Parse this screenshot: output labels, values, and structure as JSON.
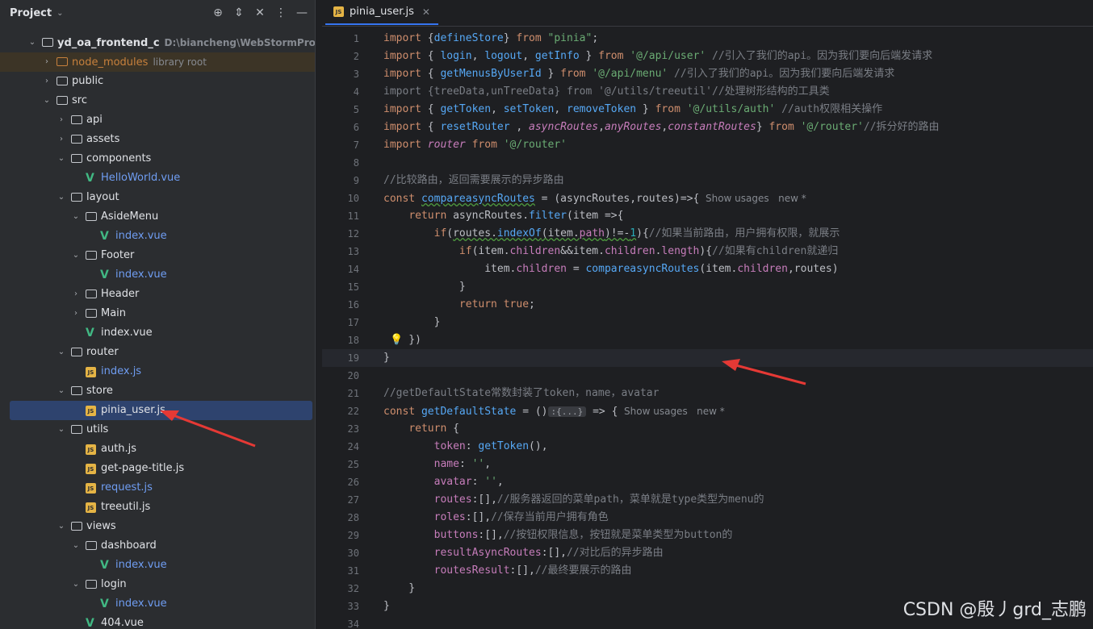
{
  "project_panel": {
    "title": "Project",
    "tree": [
      {
        "label": "yd_oa_frontend_c",
        "hint": "D:\\biancheng\\WebStormProject\\yd_oa_fr",
        "type": "folder",
        "depth": 0,
        "open": true,
        "bold": true
      },
      {
        "label": "node_modules",
        "hint": "library root",
        "type": "folder",
        "depth": 1,
        "open": false,
        "excluded": true
      },
      {
        "label": "public",
        "type": "folder",
        "depth": 1,
        "open": false
      },
      {
        "label": "src",
        "type": "folder",
        "depth": 1,
        "open": true
      },
      {
        "label": "api",
        "type": "folder",
        "depth": 2,
        "open": false
      },
      {
        "label": "assets",
        "type": "folder",
        "depth": 2,
        "open": false
      },
      {
        "label": "components",
        "type": "folder",
        "depth": 2,
        "open": true
      },
      {
        "label": "HelloWorld.vue",
        "type": "vue",
        "depth": 3,
        "blue": true
      },
      {
        "label": "layout",
        "type": "folder",
        "depth": 2,
        "open": true
      },
      {
        "label": "AsideMenu",
        "type": "folder",
        "depth": 3,
        "open": true
      },
      {
        "label": "index.vue",
        "type": "vue",
        "depth": 4,
        "blue": true
      },
      {
        "label": "Footer",
        "type": "folder",
        "depth": 3,
        "open": true
      },
      {
        "label": "index.vue",
        "type": "vue",
        "depth": 4,
        "blue": true
      },
      {
        "label": "Header",
        "type": "folder",
        "depth": 3,
        "open": false
      },
      {
        "label": "Main",
        "type": "folder",
        "depth": 3,
        "open": false
      },
      {
        "label": "index.vue",
        "type": "vue",
        "depth": 3
      },
      {
        "label": "router",
        "type": "folder",
        "depth": 2,
        "open": true
      },
      {
        "label": "index.js",
        "type": "js",
        "depth": 3,
        "blue": true
      },
      {
        "label": "store",
        "type": "folder",
        "depth": 2,
        "open": true
      },
      {
        "label": "pinia_user.js",
        "type": "js",
        "depth": 3,
        "selected": true
      },
      {
        "label": "utils",
        "type": "folder",
        "depth": 2,
        "open": true
      },
      {
        "label": "auth.js",
        "type": "js",
        "depth": 3
      },
      {
        "label": "get-page-title.js",
        "type": "js",
        "depth": 3
      },
      {
        "label": "request.js",
        "type": "js",
        "depth": 3,
        "blue": true
      },
      {
        "label": "treeutil.js",
        "type": "js",
        "depth": 3
      },
      {
        "label": "views",
        "type": "folder",
        "depth": 2,
        "open": true
      },
      {
        "label": "dashboard",
        "type": "folder",
        "depth": 3,
        "open": true
      },
      {
        "label": "index.vue",
        "type": "vue",
        "depth": 4,
        "blue": true
      },
      {
        "label": "login",
        "type": "folder",
        "depth": 3,
        "open": true
      },
      {
        "label": "index.vue",
        "type": "vue",
        "depth": 4,
        "blue": true
      },
      {
        "label": "404.vue",
        "type": "vue",
        "depth": 3
      }
    ]
  },
  "editor": {
    "tab_label": "pinia_user.js",
    "current_line": 19,
    "lines": [
      [
        [
          "k",
          "import "
        ],
        [
          "",
          "{"
        ],
        [
          "f",
          "defineStore"
        ],
        [
          "",
          "} "
        ],
        [
          "k",
          "from "
        ],
        [
          "s",
          "\"pinia\""
        ],
        [
          "",
          ";"
        ]
      ],
      [
        [
          "k",
          "import "
        ],
        [
          "",
          "{ "
        ],
        [
          "f",
          "login"
        ],
        [
          "",
          ", "
        ],
        [
          "f",
          "logout"
        ],
        [
          "",
          ", "
        ],
        [
          "f",
          "getInfo"
        ],
        [
          "",
          " } "
        ],
        [
          "k",
          "from "
        ],
        [
          "s",
          "'@/api/user'"
        ],
        [
          "c",
          " //引入了我们的api。因为我们要向后端发请求"
        ]
      ],
      [
        [
          "k",
          "import "
        ],
        [
          "",
          "{ "
        ],
        [
          "f",
          "getMenusByUserId"
        ],
        [
          "",
          " } "
        ],
        [
          "k",
          "from "
        ],
        [
          "s",
          "'@/api/menu'"
        ],
        [
          "c",
          " //引入了我们的api。因为我们要向后端发请求"
        ]
      ],
      [
        [
          "dim",
          "import {treeData,unTreeData} from '@/utils/treeutil'//处理树形结构的工具类"
        ]
      ],
      [
        [
          "k",
          "import "
        ],
        [
          "",
          "{ "
        ],
        [
          "f",
          "getToken"
        ],
        [
          "",
          ", "
        ],
        [
          "f",
          "setToken"
        ],
        [
          "",
          ", "
        ],
        [
          "f",
          "removeToken"
        ],
        [
          "",
          " } "
        ],
        [
          "k",
          "from "
        ],
        [
          "s",
          "'@/utils/auth'"
        ],
        [
          "c",
          " //auth权限相关操作"
        ]
      ],
      [
        [
          "k",
          "import "
        ],
        [
          "",
          "{ "
        ],
        [
          "f",
          "resetRouter"
        ],
        [
          "",
          " , "
        ],
        [
          "i",
          "asyncRoutes"
        ],
        [
          "",
          ","
        ],
        [
          "i",
          "anyRoutes"
        ],
        [
          "",
          ","
        ],
        [
          "i",
          "constantRoutes"
        ],
        [
          "",
          "} "
        ],
        [
          "k",
          "from "
        ],
        [
          "s",
          "'@/router'"
        ],
        [
          "c",
          "//拆分好的路由"
        ]
      ],
      [
        [
          "k",
          "import "
        ],
        [
          "i",
          "router"
        ],
        [
          "k",
          " from "
        ],
        [
          "s",
          "'@/router'"
        ]
      ],
      [],
      [
        [
          "c",
          "//比较路由，返回需要展示的异步路由"
        ]
      ],
      [
        [
          "k",
          "const "
        ],
        [
          "fu",
          "compareasyncRoutes"
        ],
        [
          "",
          " = (asyncRoutes,routes)=>{"
        ],
        [
          "inlay",
          "  Show usages   new *"
        ]
      ],
      [
        [
          "",
          "    "
        ],
        [
          "k",
          "return "
        ],
        [
          "",
          "asyncRoutes."
        ],
        [
          "f",
          "filter"
        ],
        [
          "",
          "(item =>{"
        ]
      ],
      [
        [
          "",
          "        "
        ],
        [
          "k",
          "if"
        ],
        [
          "",
          "("
        ],
        [
          "u",
          "routes."
        ],
        [
          "fu",
          "indexOf"
        ],
        [
          "u",
          "(item."
        ],
        [
          "pu",
          "path"
        ],
        [
          "u",
          ")!=-"
        ],
        [
          "mu",
          "1"
        ],
        [
          "",
          "){"
        ],
        [
          "c",
          "//如果当前路由，用户拥有权限，就展示"
        ]
      ],
      [
        [
          "",
          "            "
        ],
        [
          "k",
          "if"
        ],
        [
          "",
          "(item."
        ],
        [
          "p",
          "children"
        ],
        [
          "",
          "&&item."
        ],
        [
          "p",
          "children"
        ],
        [
          "",
          "."
        ],
        [
          "p",
          "length"
        ],
        [
          "",
          "){"
        ],
        [
          "c",
          "//如果有children就递归"
        ]
      ],
      [
        [
          "",
          "                item."
        ],
        [
          "p",
          "children"
        ],
        [
          "",
          " = "
        ],
        [
          "f",
          "compareasyncRoutes"
        ],
        [
          "",
          "(item."
        ],
        [
          "p",
          "children"
        ],
        [
          "",
          ",routes)"
        ]
      ],
      [
        [
          "",
          "            }"
        ]
      ],
      [
        [
          "",
          "            "
        ],
        [
          "k",
          "return true"
        ],
        [
          "",
          ";"
        ]
      ],
      [
        [
          "",
          "        }"
        ]
      ],
      [
        [
          "",
          "    })"
        ]
      ],
      [
        [
          "",
          "}"
        ]
      ],
      [],
      [
        [
          "c",
          "//getDefaultState常数封装了token，name，avatar"
        ]
      ],
      [
        [
          "k",
          "const "
        ],
        [
          "f",
          "getDefaultState"
        ],
        [
          "",
          " = ()"
        ],
        [
          "chip",
          ":{...}"
        ],
        [
          "",
          " => {"
        ],
        [
          "inlay",
          "  Show usages   new *"
        ]
      ],
      [
        [
          "",
          "    "
        ],
        [
          "k",
          "return "
        ],
        [
          "",
          "{"
        ]
      ],
      [
        [
          "",
          "        "
        ],
        [
          "p",
          "token"
        ],
        [
          "",
          ": "
        ],
        [
          "f",
          "getToken"
        ],
        [
          "",
          "(),"
        ]
      ],
      [
        [
          "",
          "        "
        ],
        [
          "p",
          "name"
        ],
        [
          "",
          ": "
        ],
        [
          "s",
          "''"
        ],
        [
          "",
          ","
        ]
      ],
      [
        [
          "",
          "        "
        ],
        [
          "p",
          "avatar"
        ],
        [
          "",
          ": "
        ],
        [
          "s",
          "''"
        ],
        [
          "",
          ","
        ]
      ],
      [
        [
          "",
          "        "
        ],
        [
          "p",
          "routes"
        ],
        [
          "",
          ":[],"
        ],
        [
          "c",
          "//服务器返回的菜单path，菜单就是type类型为menu的"
        ]
      ],
      [
        [
          "",
          "        "
        ],
        [
          "p",
          "roles"
        ],
        [
          "",
          ":[],"
        ],
        [
          "c",
          "//保存当前用户拥有角色"
        ]
      ],
      [
        [
          "",
          "        "
        ],
        [
          "p",
          "buttons"
        ],
        [
          "",
          ":[],"
        ],
        [
          "c",
          "//按钮权限信息，按钮就是菜单类型为button的"
        ]
      ],
      [
        [
          "",
          "        "
        ],
        [
          "p",
          "resultAsyncRoutes"
        ],
        [
          "",
          ":[],"
        ],
        [
          "c",
          "//对比后的异步路由"
        ]
      ],
      [
        [
          "",
          "        "
        ],
        [
          "p",
          "routesResult"
        ],
        [
          "",
          ":[],"
        ],
        [
          "c",
          "//最终要展示的路由"
        ]
      ],
      [
        [
          "",
          "    }"
        ]
      ],
      [
        [
          "",
          "}"
        ]
      ],
      []
    ]
  },
  "watermark": "CSDN @殷丿grd_志鹏"
}
